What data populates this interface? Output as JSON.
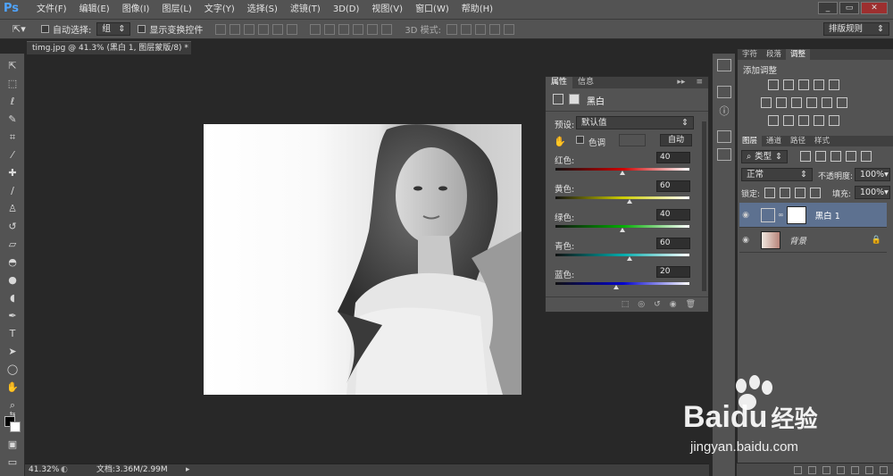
{
  "menubar": {
    "logo": "Ps",
    "items": [
      "文件(F)",
      "编辑(E)",
      "图像(I)",
      "图层(L)",
      "文字(Y)",
      "选择(S)",
      "滤镜(T)",
      "3D(D)",
      "视图(V)",
      "窗口(W)",
      "帮助(H)"
    ],
    "window_controls": [
      "_",
      "▭",
      "✕"
    ]
  },
  "optionsbar": {
    "auto_select_label": "自动选择:",
    "auto_select_value": "组",
    "show_transform_label": "显示变换控件",
    "mode_3d_label": "3D 模式:",
    "workspace_value": "排版规则"
  },
  "document": {
    "tab_label": "timg.jpg @ 41.3% (黑白 1, 图层蒙版/8) *",
    "zoom": "41.32%",
    "doc_info": "文档:3.36M/2.99M"
  },
  "properties": {
    "tabs": [
      "属性",
      "信息"
    ],
    "title": "黑白",
    "preset_label": "预设:",
    "preset_value": "默认值",
    "tint_label": "色调",
    "auto_label": "自动",
    "sliders": [
      {
        "label": "红色:",
        "value": "40",
        "knob": 0.5
      },
      {
        "label": "黄色:",
        "value": "60",
        "knob": 0.55
      },
      {
        "label": "绿色:",
        "value": "40",
        "knob": 0.5
      },
      {
        "label": "青色:",
        "value": "60",
        "knob": 0.55
      },
      {
        "label": "蓝色:",
        "value": "20",
        "knob": 0.45
      }
    ]
  },
  "adjustments_panel": {
    "tabs": [
      "字符",
      "段落",
      "调整"
    ],
    "title": "添加调整"
  },
  "layers_panel": {
    "tabs": [
      "图层",
      "通道",
      "路径",
      "样式"
    ],
    "filter_value": "类型",
    "blend_mode": "正常",
    "opacity_label": "不透明度:",
    "opacity_value": "100%",
    "lock_label": "锁定:",
    "fill_label": "填充:",
    "fill_value": "100%",
    "layers": [
      {
        "name": "黑白 1"
      },
      {
        "name": "背景"
      }
    ]
  },
  "watermark": {
    "brand": "Baidu",
    "brand_cn": "经验",
    "url": "jingyan.baidu.com"
  },
  "colors": {
    "accent": "#4fa4ff",
    "panel_bg": "#535353",
    "canvas_bg": "#282828",
    "selected_layer": "#5d7190"
  }
}
